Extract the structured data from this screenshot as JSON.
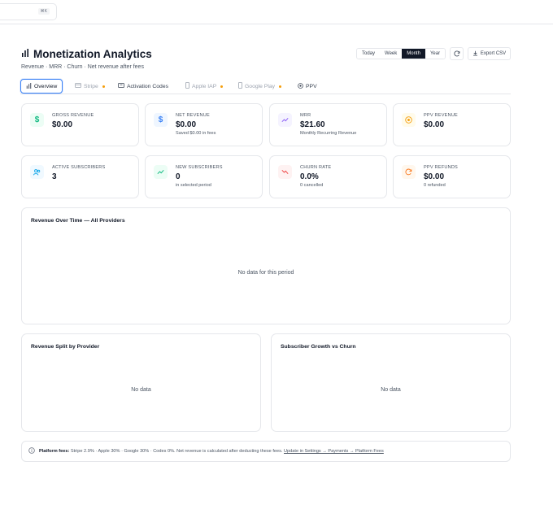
{
  "topbar": {
    "shortcut": "⌘K"
  },
  "header": {
    "title": "Monetization Analytics",
    "subtitle": "Revenue · MRR · Churn · Net revenue after fees"
  },
  "range": {
    "options": [
      "Today",
      "Week",
      "Month",
      "Year"
    ],
    "selected": "Month"
  },
  "actions": {
    "export_label": "Export CSV"
  },
  "tabs": [
    {
      "label": "Overview",
      "active": true
    },
    {
      "label": "Stripe",
      "muted": true,
      "dot": true
    },
    {
      "label": "Activation Codes"
    },
    {
      "label": "Apple IAP",
      "muted": true,
      "dot": true
    },
    {
      "label": "Google Play",
      "muted": true,
      "dot": true
    },
    {
      "label": "PPV"
    }
  ],
  "stats": [
    {
      "label": "GROSS REVENUE",
      "value": "$0.00",
      "sub": "",
      "icon": "dollar-icon",
      "color": "#10b981",
      "bg": "#ecfdf5"
    },
    {
      "label": "NET REVENUE",
      "value": "$0.00",
      "sub": "Saved $0.00 in fees",
      "icon": "dollar-icon",
      "color": "#3b82f6",
      "bg": "#eff6ff"
    },
    {
      "label": "MRR",
      "value": "$21.60",
      "sub": "Monthly Recurring Revenue",
      "icon": "trend-up-icon",
      "color": "#8b5cf6",
      "bg": "#f5f3ff"
    },
    {
      "label": "PPV REVENUE",
      "value": "$0.00",
      "sub": "",
      "icon": "target-icon",
      "color": "#f59e0b",
      "bg": "#fffbeb"
    },
    {
      "label": "ACTIVE SUBSCRIBERS",
      "value": "3",
      "sub": "",
      "icon": "users-icon",
      "color": "#0ea5e9",
      "bg": "#f0f9ff"
    },
    {
      "label": "NEW SUBSCRIBERS",
      "value": "0",
      "sub": "in selected period",
      "icon": "trend-up-icon",
      "color": "#10b981",
      "bg": "#ecfdf5"
    },
    {
      "label": "CHURN RATE",
      "value": "0.0%",
      "sub": "0 cancelled",
      "icon": "trend-down-icon",
      "color": "#ef4444",
      "bg": "#fef2f2"
    },
    {
      "label": "PPV REFUNDS",
      "value": "$0.00",
      "sub": "0 refunded",
      "icon": "refresh-icon",
      "color": "#f97316",
      "bg": "#fff7ed"
    }
  ],
  "charts": {
    "revenue_over_time": {
      "title": "Revenue Over Time — All Providers",
      "empty": "No data for this period"
    },
    "revenue_split": {
      "title": "Revenue Split by Provider",
      "empty": "No data"
    },
    "subscriber_growth": {
      "title": "Subscriber Growth vs Churn",
      "empty": "No data"
    }
  },
  "fees": {
    "label": "Platform fees:",
    "text": "Stripe 2.9% · Apple 30% · Google 30% · Codes 0%. Net revenue is calculated after deducting these fees.",
    "link": "Update in Settings → Payments → Platform Fees"
  }
}
